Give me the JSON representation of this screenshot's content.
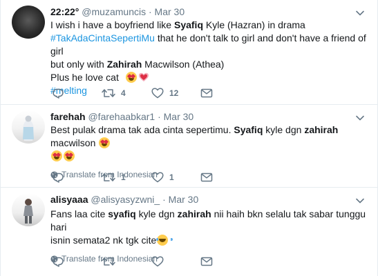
{
  "tweets": [
    {
      "fullname": "22:22°",
      "handle": "@muzamuncis",
      "separator": "·",
      "time": "Mar 30",
      "text": {
        "line1_a": "I wish i have a boyfriend like ",
        "line1_b": "Syafiq",
        "line1_c": " Kyle (Hazran) in drama",
        "line2_hashtag": "#TakAdaCintaSepertiMu",
        "line2_c": " that he don't talk to girl and don't have a friend of girl",
        "line3_a": "but only with ",
        "line3_b": "Zahirah",
        "line3_c": " Macwilson (Athea)",
        "line4": "Plus he love cat",
        "line5_hashtag": "#melting"
      },
      "reply_count": "",
      "retweet_count": "4",
      "like_count": "12"
    },
    {
      "fullname": "farehah",
      "handle": "@farehaabkar1",
      "separator": "·",
      "time": "Mar 30",
      "text": {
        "part_a": "Best pulak drama tak ada cinta sepertimu. ",
        "part_b": "Syafiq",
        "part_c": " kyle dgn ",
        "part_d": "zahirah",
        "part_e": " macwilson"
      },
      "translate": "Translate from Indonesian",
      "reply_count": "",
      "retweet_count": "1",
      "like_count": "1"
    },
    {
      "fullname": "alisyaaa",
      "handle": "@alisyasyzwni_",
      "separator": "·",
      "time": "Mar 30",
      "text": {
        "part_a": "Fans laa cite ",
        "part_b": "syafiq",
        "part_c": " kyle dgn ",
        "part_d": "zahirah",
        "part_e": " nii haih bkn selalu tak sabar tunggu hari",
        "part_f": "isnin semata2 nk tgk cite"
      },
      "translate": "Translate from Indonesian",
      "reply_count": "",
      "retweet_count": "",
      "like_count": ""
    }
  ],
  "icons": {
    "reply": "reply-icon",
    "retweet": "retweet-icon",
    "like": "heart-icon",
    "dm": "envelope-icon",
    "caret": "chevron-down-icon",
    "globe": "globe-icon"
  },
  "colors": {
    "hashtag": "#1b95e0",
    "secondary_text": "#657786",
    "divider": "#e6ecf0"
  }
}
